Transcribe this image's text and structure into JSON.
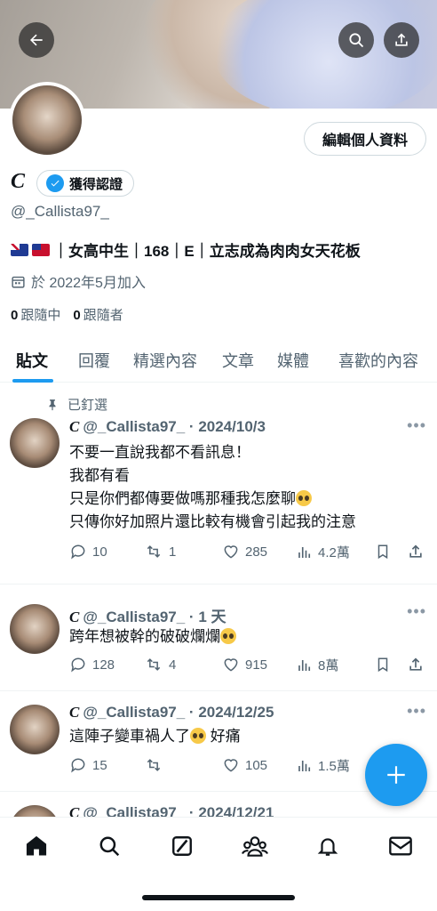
{
  "profile": {
    "name": "C",
    "verified_label": "獲得認證",
    "handle": "@_Callista97_",
    "bio": "｜女高中生｜168｜E｜立志成為肉肉女天花板",
    "joined": "於 2022年5月加入",
    "following_count": "0",
    "following_label": "跟隨中",
    "followers_count": "0",
    "followers_label": "跟隨者",
    "edit_button": "編輯個人資料"
  },
  "tabs": [
    "貼文",
    "回覆",
    "精選內容",
    "文章",
    "媒體",
    "喜歡的內容"
  ],
  "pinned_label": "已釘選",
  "posts": [
    {
      "name": "C",
      "meta": "@_Callista97_ · 2024/10/3",
      "text": "不要一直說我都不看訊息！\n我都有看\n只是你們都傳要做嗎那種我怎麼聊",
      "text_line4": "只傳你好加照片還比較有機會引起我的注意",
      "replies": "10",
      "reposts": "1",
      "likes": "285",
      "views": "4.2萬"
    },
    {
      "name": "C",
      "meta": "@_Callista97_ · 1 天",
      "text": "跨年想被幹的破破爛爛",
      "replies": "128",
      "reposts": "4",
      "likes": "915",
      "views": "8萬"
    },
    {
      "name": "C",
      "meta": "@_Callista97_ · 2024/12/25",
      "text_a": "這陣子變車禍人了",
      "text_b": "好痛",
      "replies": "15",
      "reposts": "",
      "likes": "105",
      "views": "1.5萬"
    },
    {
      "name": "C",
      "meta": "@_Callista97_ · 2024/12/21"
    }
  ],
  "colors": {
    "accent": "#1d9bf0",
    "muted": "#536471",
    "text": "#0f1419"
  }
}
